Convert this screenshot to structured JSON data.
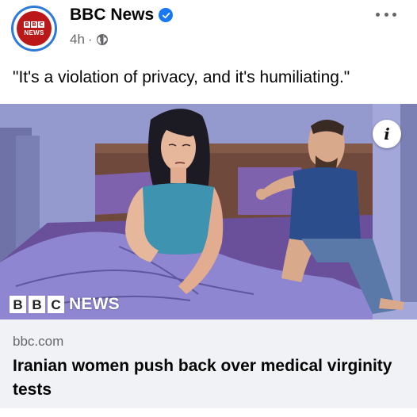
{
  "post": {
    "page_name": "BBC News",
    "avatar_logo_text": "BBC NEWS",
    "avatar_logo_blocks": [
      "B",
      "B",
      "C"
    ],
    "time": "4h",
    "separator": "·",
    "audience_icon": "globe-icon",
    "verified_icon": "verified-badge-icon",
    "more_icon": "more-options-icon",
    "caption": "\"It's a violation of privacy, and it's humiliating.\""
  },
  "image": {
    "info_label": "i",
    "watermark_blocks": [
      "B",
      "B",
      "C"
    ],
    "watermark_text": "NEWS",
    "alt": "Illustration of a woman sitting in bed while a man shouts and points at her"
  },
  "link": {
    "domain": "bbc.com",
    "headline": "Iranian women push back over medical virginity tests"
  },
  "colors": {
    "bbc_red": "#bb1919",
    "facebook_blue": "#1877f2",
    "secondary_text": "#65676b",
    "preview_bg": "#f0f2f5"
  }
}
